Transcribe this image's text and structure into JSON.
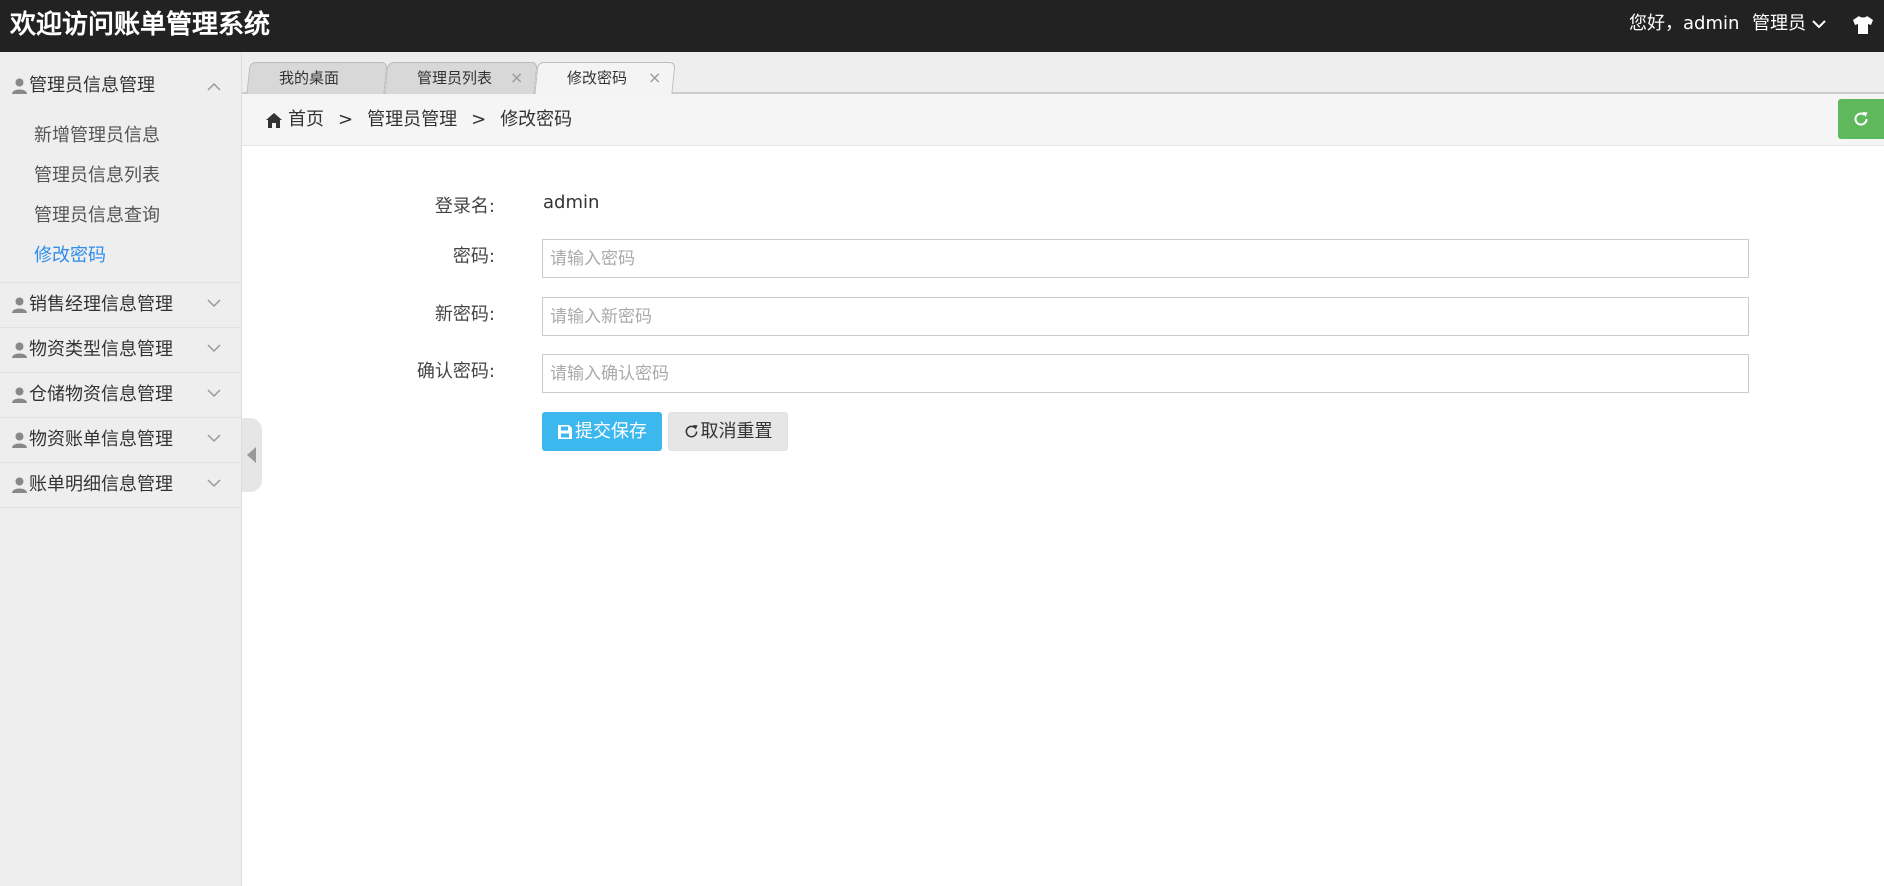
{
  "header": {
    "title": "欢迎访问账单管理系统",
    "greeting": "您好，admin",
    "role": "管理员",
    "bg_color": "#222222"
  },
  "sidebar": {
    "groups": [
      {
        "label": "管理员信息管理",
        "expanded": true,
        "items": [
          "新增管理员信息",
          "管理员信息列表",
          "管理员信息查询",
          "修改密码"
        ],
        "active_item": "修改密码"
      },
      {
        "label": "销售经理信息管理",
        "expanded": false
      },
      {
        "label": "物资类型信息管理",
        "expanded": false
      },
      {
        "label": "仓储物资信息管理",
        "expanded": false
      },
      {
        "label": "物资账单信息管理",
        "expanded": false
      },
      {
        "label": "账单明细信息管理",
        "expanded": false
      }
    ],
    "active_color": "#2e8ded"
  },
  "tabs": [
    {
      "label": "我的桌面",
      "closable": false,
      "active": false
    },
    {
      "label": "管理员列表",
      "closable": true,
      "active": false
    },
    {
      "label": "修改密码",
      "closable": true,
      "active": true
    }
  ],
  "tab_close_glyph": "×",
  "breadcrumb": {
    "home": "首页",
    "separator": ">",
    "items": [
      "管理员管理",
      "修改密码"
    ]
  },
  "form": {
    "login_label": "登录名:",
    "login_value": "admin",
    "password_label": "密码:",
    "password_placeholder": "请输入密码",
    "new_password_label": "新密码:",
    "new_password_placeholder": "请输入新密码",
    "confirm_label": "确认密码:",
    "confirm_placeholder": "请输入确认密码",
    "submit_label": "提交保存",
    "cancel_label": "取消重置"
  },
  "colors": {
    "submit_button": "#3db8ef",
    "refresh_button": "#5fb85c"
  }
}
